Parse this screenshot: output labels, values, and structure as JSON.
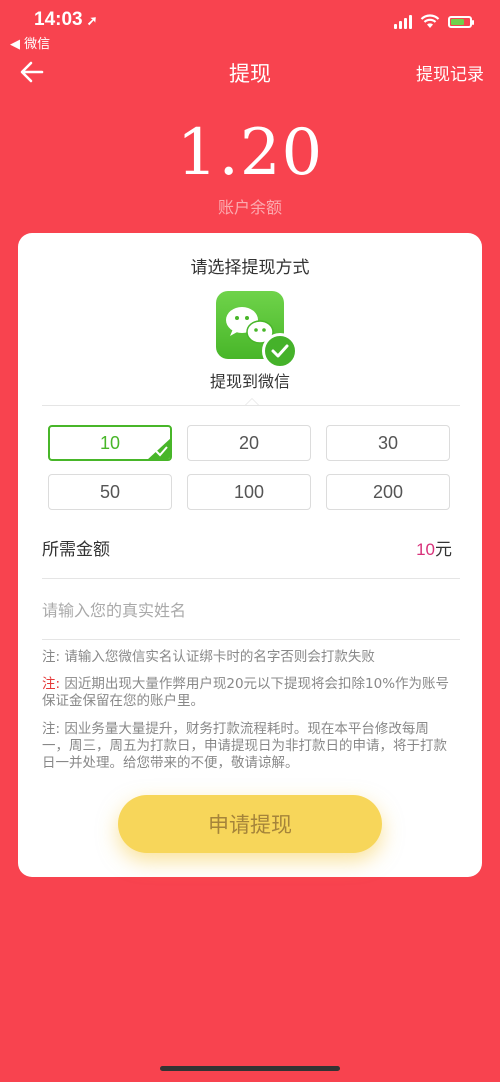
{
  "status": {
    "time": "14:03",
    "back_app": "◀ 微信",
    "battery_level": 0.7
  },
  "nav": {
    "title": "提现",
    "record": "提现记录"
  },
  "balance": {
    "value": "1.20",
    "label": "账户余额"
  },
  "card": {
    "title": "请选择提现方式",
    "method_label": "提现到微信",
    "amounts": [
      "10",
      "20",
      "30",
      "50",
      "100",
      "200"
    ],
    "selected_amount": "10",
    "need_label": "所需金额",
    "need_value": "10",
    "need_unit": "元",
    "name_placeholder": "请输入您的真实姓名",
    "note1": "注: 请输入您微信实名认证绑卡时的名字否则会打款失败",
    "note2_prefix": "注:",
    "note2_text": " 因近期出现大量作弊用户现20元以下提现将会扣除10%作为账号保证金保留在您的账户里。",
    "note3": "注: 因业务量大量提升，财务打款流程耗时。现在本平台修改每周一，周三，周五为打款日，申请提现日为非打款日的申请，将于打款日一并处理。给您带来的不便，敬请谅解。",
    "submit": "申请提现"
  },
  "colors": {
    "background": "#f8434f",
    "wechat_green": "#48b629",
    "button": "#f7d65a",
    "accent_amount": "#d8317a"
  }
}
